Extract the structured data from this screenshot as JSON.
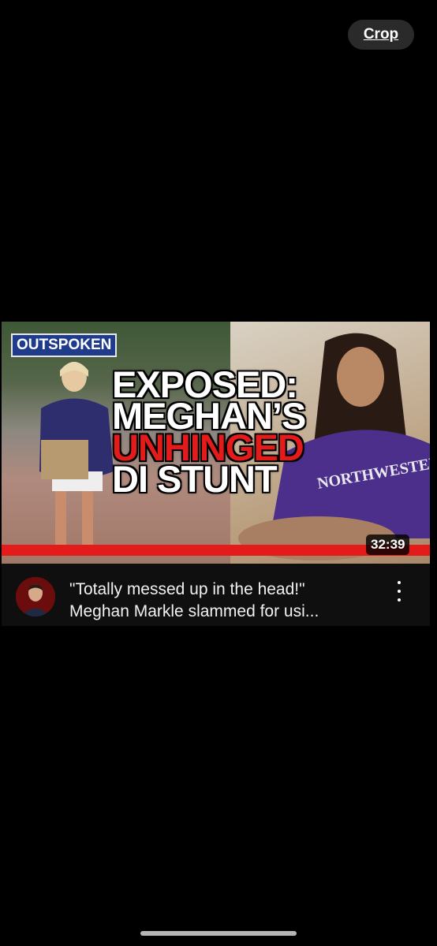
{
  "toolbar": {
    "crop_label": "Crop"
  },
  "video": {
    "thumbnail": {
      "badge": "OUTSPOKEN",
      "headline": [
        "EXPOSED:",
        "MEGHAN’S",
        "UNHINGED",
        "DI STUNT"
      ],
      "sweatshirt_text": "NORTHWESTERN",
      "duration": "32:39",
      "accent_color": "#e41b1b",
      "badge_color": "#1f3b8c"
    },
    "title_line1": "\"Totally messed up in the head!\"",
    "title_line2": "Meghan Markle slammed for usi...",
    "channel_avatar": "channel-avatar",
    "menu_icon": "kebab-menu-icon"
  }
}
